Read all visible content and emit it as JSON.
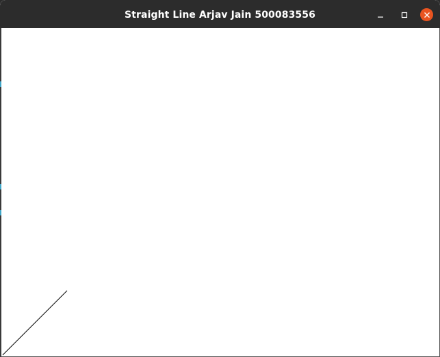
{
  "window": {
    "title": "Straight Line Arjav Jain 500083556",
    "controls": {
      "minimize": "minimize-icon",
      "maximize": "maximize-icon",
      "close": "close-icon"
    },
    "accent_color": "#e95420",
    "titlebar_color": "#2c2c2c"
  },
  "canvas": {
    "background": "#ffffff",
    "line_color": "#000000"
  }
}
